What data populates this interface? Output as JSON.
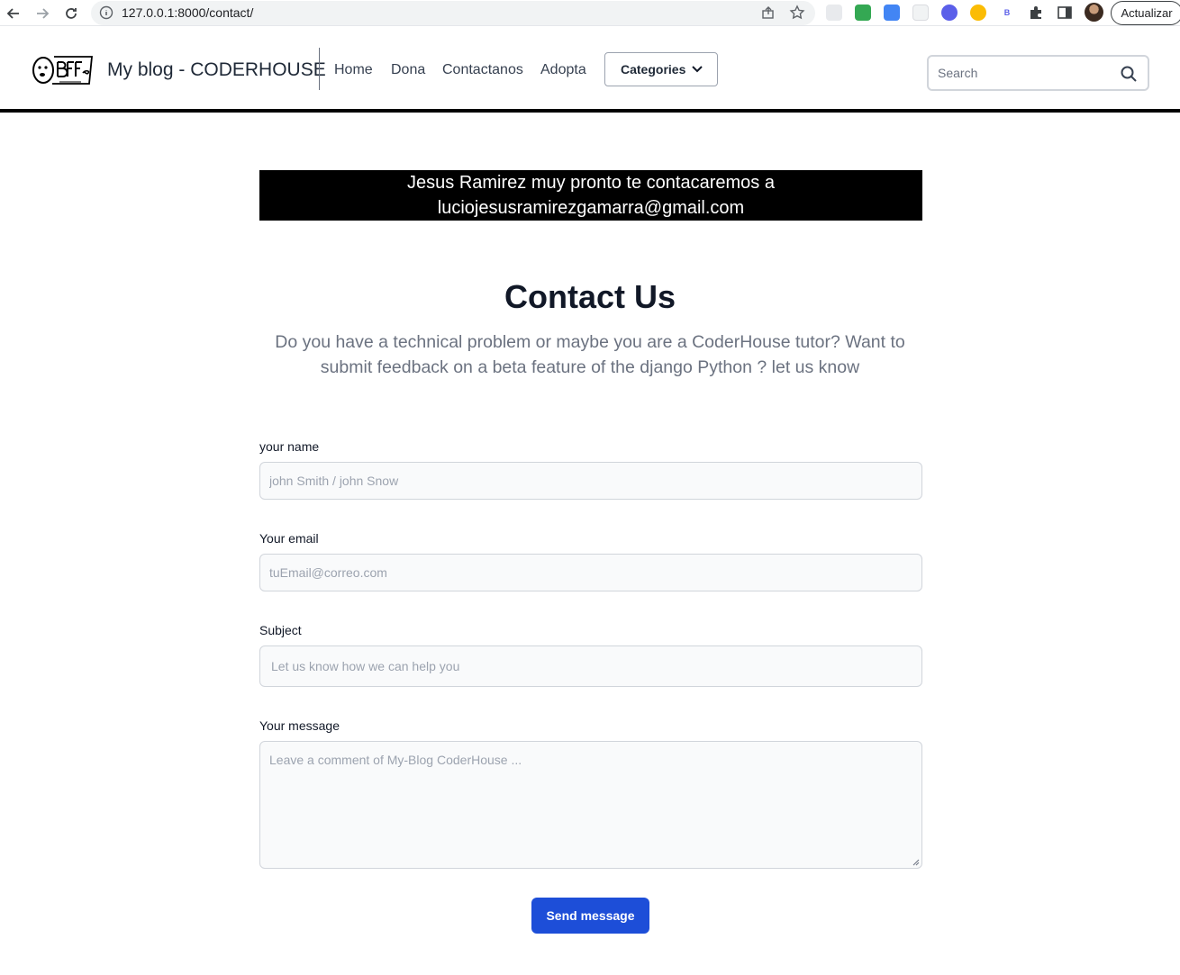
{
  "browser": {
    "url": "127.0.0.1:8000/contact/",
    "update_label": "Actualizar"
  },
  "navbar": {
    "brand": "My blog - CODERHOUSE",
    "links": [
      "Home",
      "Dona",
      "Contactanos",
      "Adopta"
    ],
    "categories_label": "Categories",
    "search_placeholder": "Search"
  },
  "alert": {
    "line1": "Jesus Ramirez muy pronto te contacaremos a",
    "line2": "luciojesusramirezgamarra@gmail.com"
  },
  "contact": {
    "title": "Contact Us",
    "subtitle": "Do you have a technical problem or maybe you are a CoderHouse tutor? Want to submit feedback on a beta feature of the django Python ? let us know"
  },
  "form": {
    "name_label": "your name",
    "name_placeholder": "john Smith / john Snow",
    "email_label": "Your email",
    "email_placeholder": "tuEmail@correo.com",
    "subject_label": "Subject",
    "subject_placeholder": "Let us know how we can help you",
    "message_label": "Your message",
    "message_placeholder": "Leave a comment of My-Blog CoderHouse ...",
    "send_label": "Send message"
  },
  "colors": {
    "primary": "#1d4ed8",
    "alert_bg": "#000000"
  }
}
